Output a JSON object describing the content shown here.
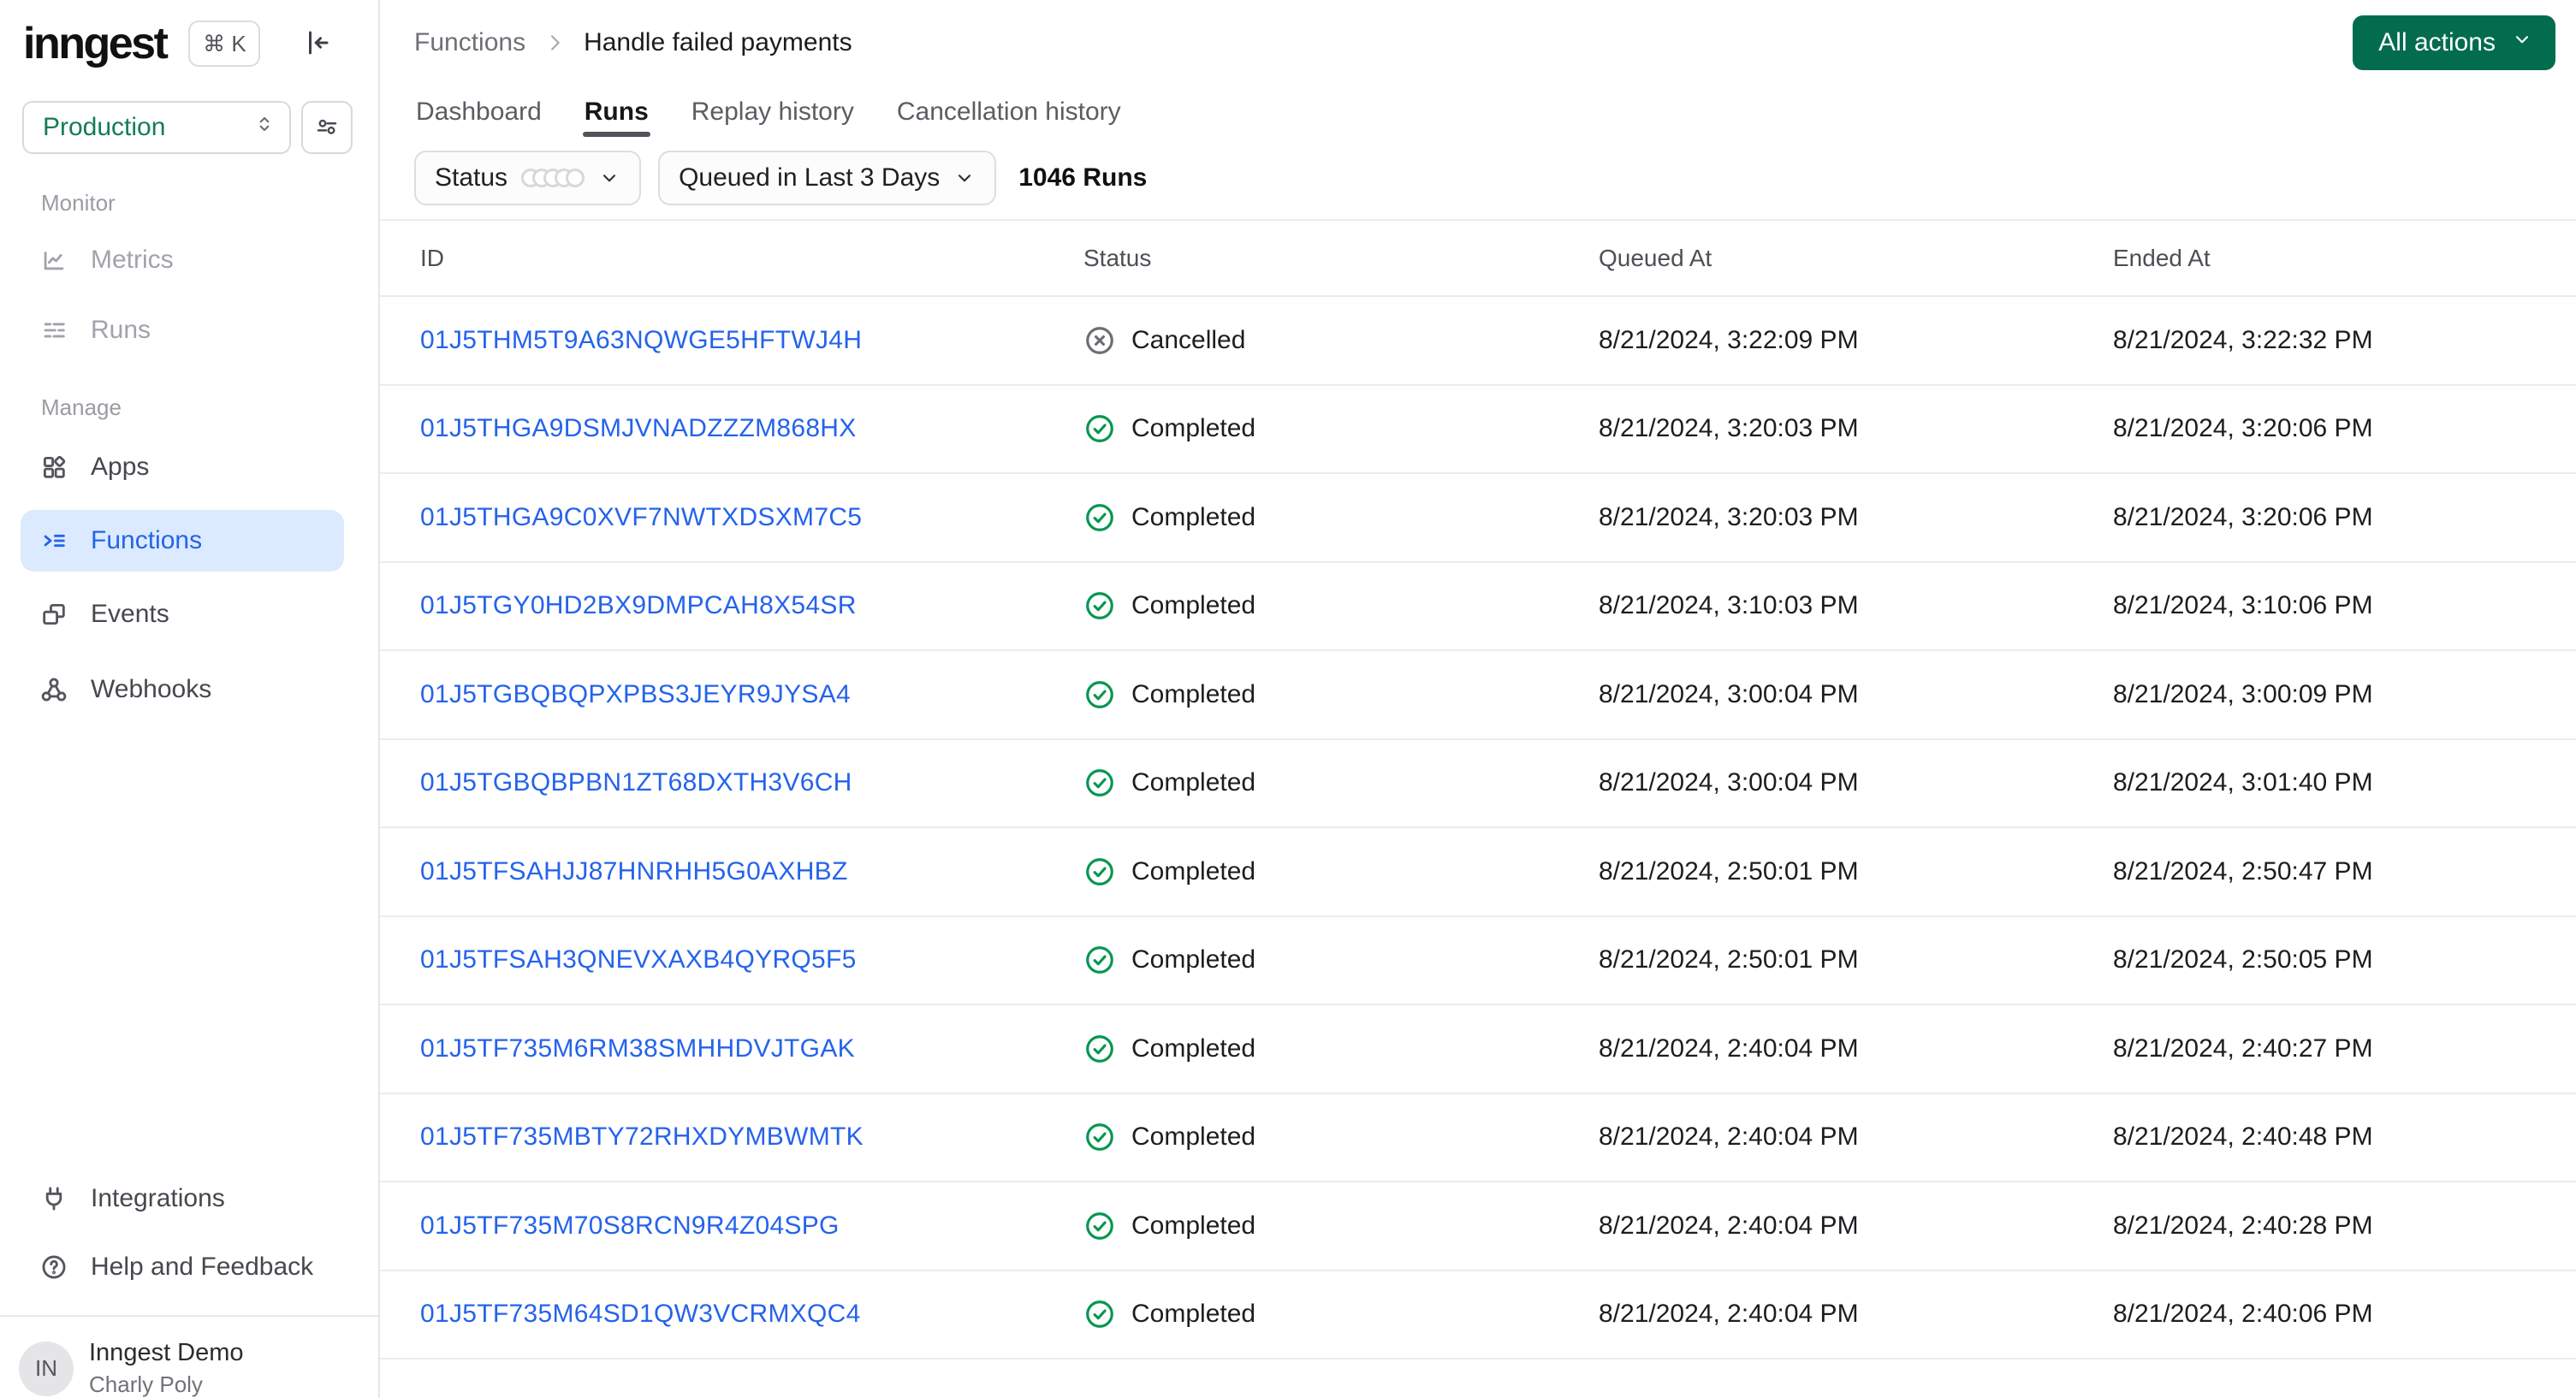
{
  "colors": {
    "accent_green_button": "#046c4e",
    "environment_green": "#147d52",
    "link_blue": "#2563eb",
    "active_nav_bg": "#dbeafe",
    "completed_green": "#079650",
    "cancelled_gray": "#6d6d74"
  },
  "sidebar": {
    "logo": "inngest",
    "shortcut": "⌘ K",
    "environment": "Production",
    "sections": [
      {
        "label": "Monitor",
        "items": [
          {
            "label": "Metrics"
          },
          {
            "label": "Runs"
          }
        ]
      },
      {
        "label": "Manage",
        "items": [
          {
            "label": "Apps"
          },
          {
            "label": "Functions"
          },
          {
            "label": "Events"
          },
          {
            "label": "Webhooks"
          }
        ]
      }
    ],
    "footer_items": [
      {
        "label": "Integrations"
      },
      {
        "label": "Help and Feedback"
      }
    ],
    "account": {
      "initials": "IN",
      "org": "Inngest Demo",
      "user": "Charly Poly"
    }
  },
  "header": {
    "breadcrumb": [
      "Functions",
      "Handle failed payments"
    ],
    "action_button": "All actions"
  },
  "tabs": [
    {
      "label": "Dashboard"
    },
    {
      "label": "Runs",
      "active": true
    },
    {
      "label": "Replay history"
    },
    {
      "label": "Cancellation history"
    }
  ],
  "filters": {
    "status_label": "Status",
    "time_range": "Queued in Last 3 Days",
    "runs_count": "1046 Runs"
  },
  "table": {
    "columns": [
      "ID",
      "Status",
      "Queued At",
      "Ended At"
    ],
    "rows": [
      {
        "id": "01J5THM5T9A63NQWGE5HFTWJ4H",
        "status_label": "Cancelled",
        "status_type": "cancelled",
        "queued_at": "8/21/2024, 3:22:09 PM",
        "ended_at": "8/21/2024, 3:22:32 PM"
      },
      {
        "id": "01J5THGA9DSMJVNADZZZM868HX",
        "status_label": "Completed",
        "status_type": "completed",
        "queued_at": "8/21/2024, 3:20:03 PM",
        "ended_at": "8/21/2024, 3:20:06 PM"
      },
      {
        "id": "01J5THGA9C0XVF7NWTXDSXM7C5",
        "status_label": "Completed",
        "status_type": "completed",
        "queued_at": "8/21/2024, 3:20:03 PM",
        "ended_at": "8/21/2024, 3:20:06 PM"
      },
      {
        "id": "01J5TGY0HD2BX9DMPCAH8X54SR",
        "status_label": "Completed",
        "status_type": "completed",
        "queued_at": "8/21/2024, 3:10:03 PM",
        "ended_at": "8/21/2024, 3:10:06 PM"
      },
      {
        "id": "01J5TGBQBQPXPBS3JEYR9JYSA4",
        "status_label": "Completed",
        "status_type": "completed",
        "queued_at": "8/21/2024, 3:00:04 PM",
        "ended_at": "8/21/2024, 3:00:09 PM"
      },
      {
        "id": "01J5TGBQBPBN1ZT68DXTH3V6CH",
        "status_label": "Completed",
        "status_type": "completed",
        "queued_at": "8/21/2024, 3:00:04 PM",
        "ended_at": "8/21/2024, 3:01:40 PM"
      },
      {
        "id": "01J5TFSAHJJ87HNRHH5G0AXHBZ",
        "status_label": "Completed",
        "status_type": "completed",
        "queued_at": "8/21/2024, 2:50:01 PM",
        "ended_at": "8/21/2024, 2:50:47 PM"
      },
      {
        "id": "01J5TFSAH3QNEVXAXB4QYRQ5F5",
        "status_label": "Completed",
        "status_type": "completed",
        "queued_at": "8/21/2024, 2:50:01 PM",
        "ended_at": "8/21/2024, 2:50:05 PM"
      },
      {
        "id": "01J5TF735M6RM38SMHHDVJTGAK",
        "status_label": "Completed",
        "status_type": "completed",
        "queued_at": "8/21/2024, 2:40:04 PM",
        "ended_at": "8/21/2024, 2:40:27 PM"
      },
      {
        "id": "01J5TF735MBTY72RHXDYMBWMTK",
        "status_label": "Completed",
        "status_type": "completed",
        "queued_at": "8/21/2024, 2:40:04 PM",
        "ended_at": "8/21/2024, 2:40:48 PM"
      },
      {
        "id": "01J5TF735M70S8RCN9R4Z04SPG",
        "status_label": "Completed",
        "status_type": "completed",
        "queued_at": "8/21/2024, 2:40:04 PM",
        "ended_at": "8/21/2024, 2:40:28 PM"
      },
      {
        "id": "01J5TF735M64SD1QW3VCRMXQC4",
        "status_label": "Completed",
        "status_type": "completed",
        "queued_at": "8/21/2024, 2:40:04 PM",
        "ended_at": "8/21/2024, 2:40:06 PM"
      }
    ]
  }
}
